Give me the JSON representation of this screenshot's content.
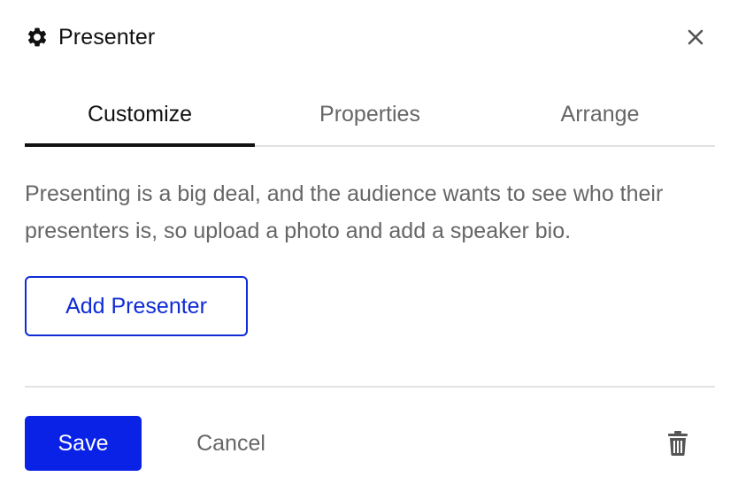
{
  "header": {
    "icon": "gear-icon",
    "title": "Presenter",
    "close_icon": "close-icon"
  },
  "tabs": [
    {
      "label": "Customize",
      "active": true
    },
    {
      "label": "Properties",
      "active": false
    },
    {
      "label": "Arrange",
      "active": false
    }
  ],
  "content": {
    "description": "Presenting is a big deal, and the audience wants to see who their presenters is, so upload a photo and add a speaker bio.",
    "add_presenter_label": "Add Presenter"
  },
  "footer": {
    "save_label": "Save",
    "cancel_label": "Cancel",
    "delete_icon": "trash-icon"
  },
  "colors": {
    "accent": "#0a22e6",
    "accent_outline": "#0f2bd6",
    "text_primary": "#111111",
    "text_secondary": "#666666",
    "divider": "#e2e2e2"
  }
}
